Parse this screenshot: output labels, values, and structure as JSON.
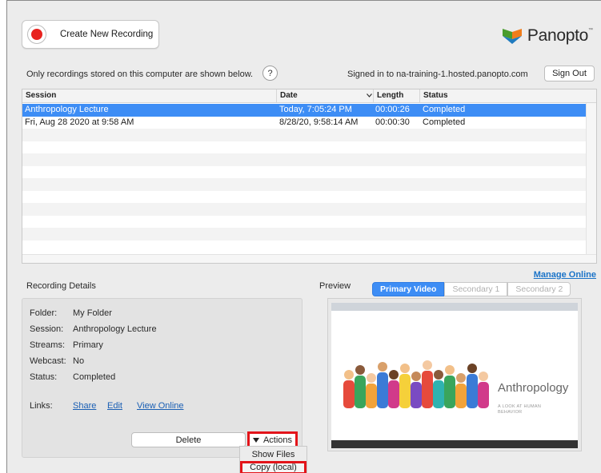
{
  "toolbar": {
    "create_label": "Create New Recording"
  },
  "brand": {
    "name": "Panopto",
    "tm": "™",
    "colors": [
      "#4a9c2d",
      "#f07d1b",
      "#1f7bbf"
    ]
  },
  "info": {
    "text": "Only recordings stored on this computer are shown below.",
    "help": "?"
  },
  "account": {
    "signed_in": "Signed in to na-training-1.hosted.panopto.com",
    "sign_out": "Sign Out"
  },
  "table": {
    "headers": {
      "session": "Session",
      "date": "Date",
      "length": "Length",
      "status": "Status"
    },
    "rows": [
      {
        "session": "Anthropology Lecture",
        "date": "Today, 7:05:24 PM",
        "length": "00:00:26",
        "status": "Completed",
        "selected": true
      },
      {
        "session": "Fri, Aug 28 2020 at 9:58 AM",
        "date": "8/28/20, 9:58:14 AM",
        "length": "00:00:30",
        "status": "Completed",
        "selected": false
      }
    ]
  },
  "manage_online": "Manage Online",
  "details": {
    "title": "Recording Details",
    "folder_label": "Folder:",
    "folder": "My Folder",
    "session_label": "Session:",
    "session": "Anthropology Lecture",
    "streams_label": "Streams:",
    "streams": "Primary",
    "webcast_label": "Webcast:",
    "webcast": "No",
    "status_label": "Status:",
    "status": "Completed",
    "links_label": "Links:",
    "links": {
      "share": "Share",
      "edit": "Edit",
      "view_online": "View Online"
    },
    "delete": "Delete",
    "actions": "Actions"
  },
  "menu": {
    "show_files": "Show Files",
    "copy_local": "Copy (local)"
  },
  "preview": {
    "title": "Preview",
    "tabs": {
      "primary": "Primary Video",
      "secondary1": "Secondary 1",
      "secondary2": "Secondary 2"
    },
    "slide_title": "Anthropology",
    "slide_sub1": "A LOOK AT HUMAN",
    "slide_sub2": "BEHAVIOR"
  },
  "accent_colors": {
    "selection": "#3d8df5",
    "record": "#e8231f",
    "highlight": "#e3141a",
    "link": "#1a73c8"
  }
}
